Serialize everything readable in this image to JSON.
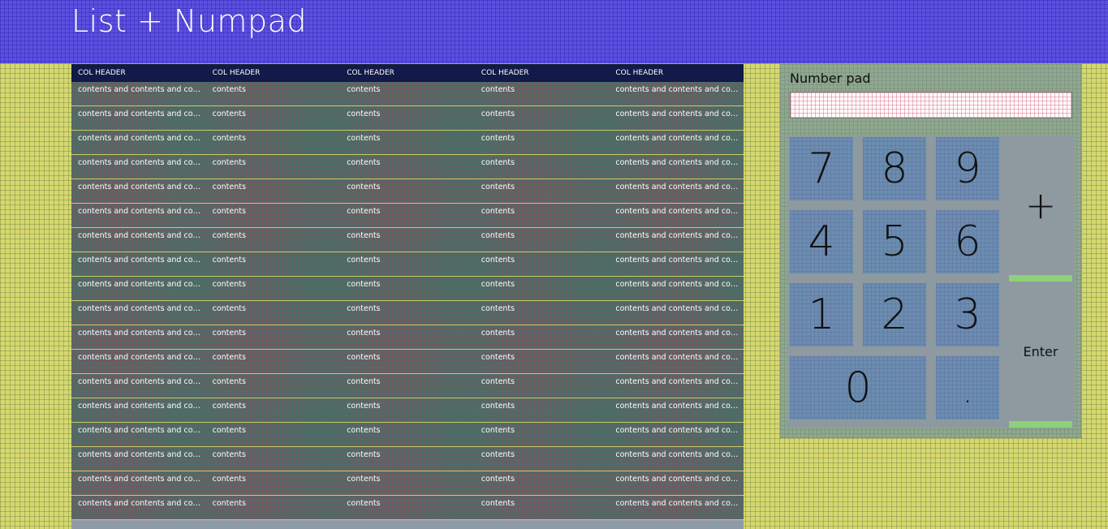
{
  "app": {
    "title": "List + Numpad"
  },
  "list": {
    "headers": [
      "COL HEADER",
      "COL HEADER",
      "COL HEADER",
      "COL HEADER",
      "COL HEADER"
    ],
    "row": {
      "col1": "contents and contents and contents",
      "col2": "contents",
      "col3": "contents",
      "col4": "contents",
      "col5": "contents and contents and contents"
    },
    "row_count": 18
  },
  "numpad": {
    "label": "Number pad",
    "input_value": "",
    "keys": {
      "k7": "7",
      "k8": "8",
      "k9": "9",
      "k4": "4",
      "k5": "5",
      "k6": "6",
      "k1": "1",
      "k2": "2",
      "k3": "3",
      "k0": "0",
      "dot": ".",
      "plus": "+",
      "enter": "Enter"
    }
  },
  "colors": {
    "header_bg": "#5a4fe0",
    "page_bg": "#d6d86e",
    "list_bg": "#4f6c66",
    "list_header_bg": "#111a48",
    "key_bg": "#6b8db0",
    "accent_green": "#8fd07a"
  }
}
